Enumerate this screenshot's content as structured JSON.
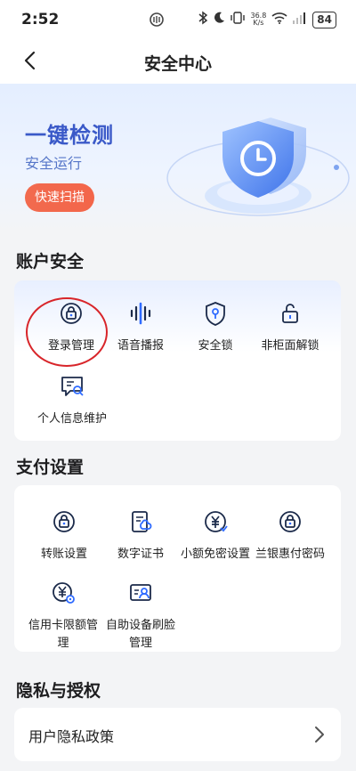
{
  "status": {
    "time": "2:52",
    "speed_value": "36.8",
    "speed_unit": "K/s",
    "battery": "84"
  },
  "nav": {
    "title": "安全中心"
  },
  "hero": {
    "title": "一键检测",
    "subtitle": "安全运行",
    "scan_button": "快速扫描"
  },
  "account": {
    "title": "账户安全",
    "items": [
      {
        "label": "登录管理",
        "icon": "lock-icon"
      },
      {
        "label": "语音播报",
        "icon": "voice-wave-icon"
      },
      {
        "label": "安全锁",
        "icon": "shield-key-icon"
      },
      {
        "label": "非柜面解锁",
        "icon": "unlock-icon"
      },
      {
        "label": "个人信息维护",
        "icon": "person-info-icon"
      }
    ]
  },
  "payment": {
    "title": "支付设置",
    "items": [
      {
        "label": "转账设置",
        "icon": "lock-icon"
      },
      {
        "label": "数字证书",
        "icon": "certificate-icon"
      },
      {
        "label": "小额免密设置",
        "icon": "yuan-icon"
      },
      {
        "label": "兰银惠付密码",
        "icon": "lock-icon"
      },
      {
        "label": "信用卡限额管理",
        "icon": "yuan-gear-icon"
      },
      {
        "label": "自助设备刷脸管理",
        "icon": "face-id-icon"
      }
    ]
  },
  "privacy": {
    "title": "隐私与授权",
    "items": [
      {
        "label": "用户隐私政策"
      }
    ]
  },
  "colors": {
    "accent": "#3a59c8",
    "scan": "#f26a4e",
    "icon": "#1b2a4a",
    "icon_accent": "#2f6bff",
    "highlight": "#d8252a"
  }
}
